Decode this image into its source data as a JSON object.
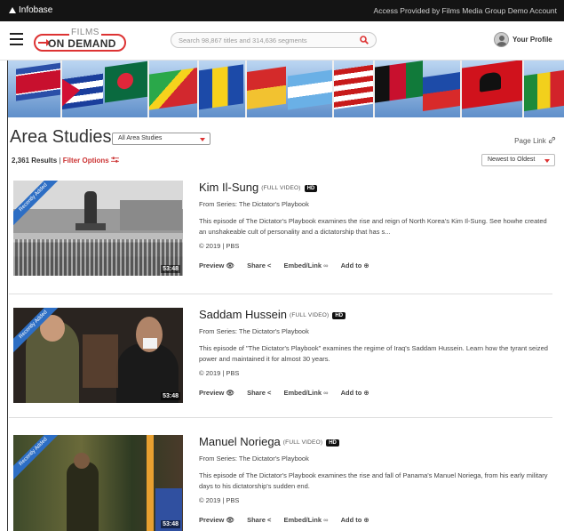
{
  "topbar": {
    "brand": "Infobase",
    "access_text": "Access Provided by Films Media Group Demo Account"
  },
  "header": {
    "logo_top": "FILMS",
    "logo_bottom": "ON DEMAND",
    "search_placeholder": "Search 98,867 titles and 314,636 segments",
    "profile_label": "Your Profile"
  },
  "page": {
    "title": "Area Studies",
    "dropdown_value": "All Area Studies",
    "page_link": "Page Link",
    "results_count": "2,361 Results",
    "results_sep": "|",
    "filter_label": "Filter Options",
    "sort_value": "Newest to Oldest"
  },
  "results": [
    {
      "title": "Kim Il-Sung",
      "tag": "(FULL VIDEO)",
      "hd": "HD",
      "series": "From Series: The Dictator's Playbook",
      "description": "This episode of The Dictator's Playbook examines the rise and reign of North Korea's Kim Il-Sung. See howhe created an unshakeable cult of personality and a dictatorship that has s...",
      "meta": "© 2019 | PBS",
      "duration": "53:48",
      "ribbon": "Recently Added"
    },
    {
      "title": "Saddam Hussein",
      "tag": "(FULL VIDEO)",
      "hd": "HD",
      "series": "From Series: The Dictator's Playbook",
      "description": "This episode of \"The Dictator's Playbook\" examines the regime of Iraq's Saddam Hussein. Learn how the tyrant seized power and maintained it for almost 30 years.",
      "meta": "© 2019 | PBS",
      "duration": "53:48",
      "ribbon": "Recently Added"
    },
    {
      "title": "Manuel Noriega",
      "tag": "(FULL VIDEO)",
      "hd": "HD",
      "series": "From Series: The Dictator's Playbook",
      "description": "This episode of The Dictator's Playbook examines the rise and fall of Panama's Manuel Noriega, from his early military days to his dictatorship's sudden end.",
      "meta": "© 2019 | PBS",
      "duration": "53:48",
      "ribbon": "Recently Added"
    }
  ],
  "actions": {
    "preview": "Preview",
    "share": "Share",
    "embed": "Embed/Link",
    "addto": "Add to"
  },
  "colors": {
    "accent_red": "#d33333",
    "ribbon_blue": "#2d6ec4",
    "topbar": "#141414"
  }
}
